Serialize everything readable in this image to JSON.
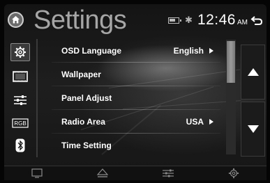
{
  "header": {
    "title": "Settings",
    "time": "12:46",
    "ampm": "AM",
    "icons": [
      "home-icon",
      "battery-icon",
      "bluetooth-icon",
      "back-icon"
    ]
  },
  "sidebar": {
    "items": [
      {
        "name": "settings-gear-icon",
        "active": true
      },
      {
        "name": "wallpaper-screen-icon",
        "active": false
      },
      {
        "name": "sliders-icon",
        "active": false
      },
      {
        "name": "rgb-icon",
        "label": "RGB",
        "active": false
      },
      {
        "name": "bluetooth-icon",
        "active": false
      }
    ]
  },
  "list": {
    "rows": [
      {
        "label": "OSD Language",
        "value": "English",
        "has_arrow": true
      },
      {
        "label": "Wallpaper",
        "value": "",
        "has_arrow": false
      },
      {
        "label": "Panel Adjust",
        "value": "",
        "has_arrow": false
      },
      {
        "label": "Radio Area",
        "value": "USA",
        "has_arrow": true
      },
      {
        "label": "Time Setting",
        "value": "",
        "has_arrow": false
      }
    ]
  },
  "scroll": {
    "up_icon": "up-arrow-icon",
    "down_icon": "down-arrow-icon"
  },
  "bottom_bar": {
    "items": [
      "display-icon",
      "eject-icon",
      "equalizer-icon",
      "gear-icon"
    ]
  },
  "colors": {
    "background": "#1a1a1a",
    "title": "#a6a6a6",
    "text": "#ffffff"
  }
}
